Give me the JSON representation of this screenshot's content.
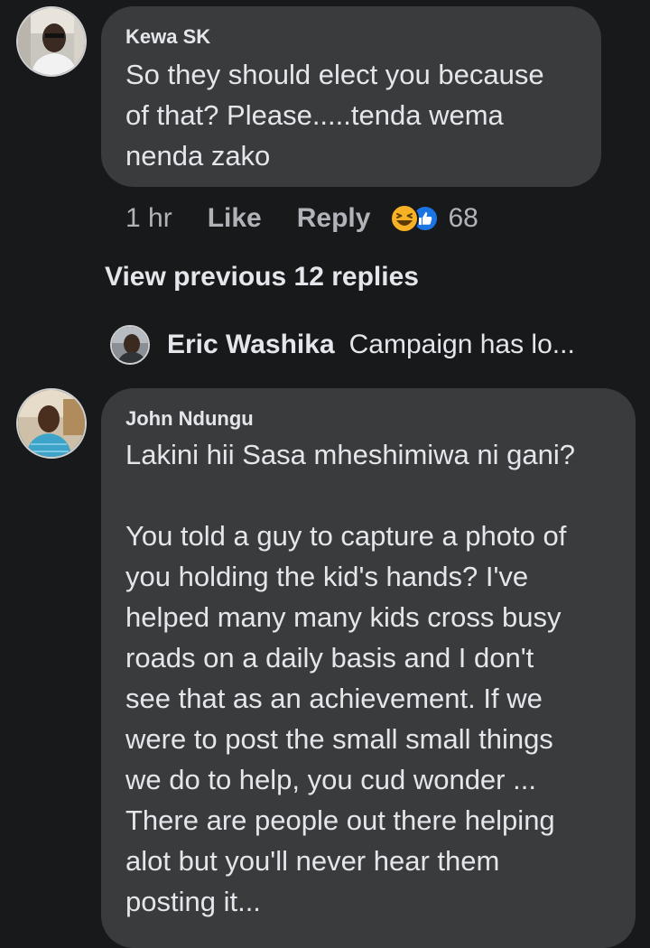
{
  "comments": [
    {
      "author": "Kewa SK",
      "text": "So they should elect you because\nof that? Please.....tenda wema\nnenda zako",
      "time": "1 hr",
      "like_label": "Like",
      "reply_label": "Reply",
      "reaction_count": "68",
      "reactions": [
        "haha-reaction-icon",
        "like-reaction-icon"
      ]
    },
    {
      "author": "John Ndungu",
      "text": "Lakini hii Sasa mheshimiwa ni gani?\n\nYou told a guy to capture a photo of\nyou holding the kid's hands? I've\nhelped many many kids cross busy\nroads on a daily basis and I don't\nsee that as an achievement. If we\nwere to post the small small things\nwe do to help, you cud wonder ...\nThere are people out there helping\nalot but you'll never hear them\nposting it..."
    }
  ],
  "replies_thread": {
    "view_previous_label": "View previous 12 replies",
    "preview_author": "Eric Washika",
    "preview_text": "Campaign has lo..."
  },
  "colors": {
    "background": "#18191a",
    "bubble": "#3a3b3c",
    "primary_text": "#e4e6eb",
    "secondary_text": "#b0b3b8",
    "haha_yellow": "#f7b125",
    "like_blue": "#1b74e4"
  }
}
